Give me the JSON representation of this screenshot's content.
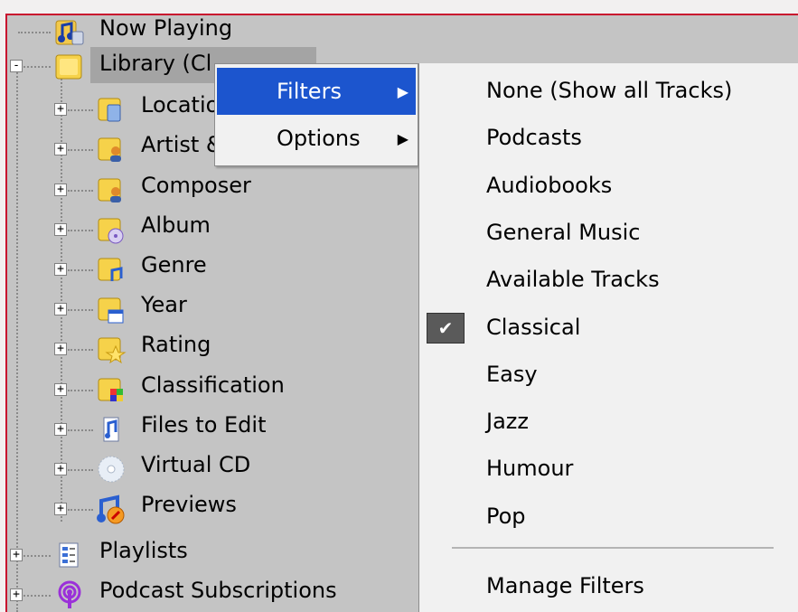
{
  "tree": {
    "items": [
      {
        "label": "Now Playing",
        "icon": "now-playing-icon",
        "expander": ""
      },
      {
        "label": "Library (Cl",
        "icon": "library-folder-icon",
        "expander": "-"
      },
      {
        "label": "Locatio",
        "icon": "location-folder-icon",
        "expander": "+"
      },
      {
        "label": "Artist &",
        "icon": "artist-folder-icon",
        "expander": "+"
      },
      {
        "label": "Composer",
        "icon": "composer-folder-icon",
        "expander": "+"
      },
      {
        "label": "Album",
        "icon": "album-folder-icon",
        "expander": "+"
      },
      {
        "label": "Genre",
        "icon": "genre-folder-icon",
        "expander": "+"
      },
      {
        "label": "Year",
        "icon": "year-folder-icon",
        "expander": "+"
      },
      {
        "label": "Rating",
        "icon": "rating-folder-icon",
        "expander": "+"
      },
      {
        "label": "Classification",
        "icon": "classification-folder-icon",
        "expander": "+"
      },
      {
        "label": "Files to Edit",
        "icon": "files-to-edit-icon",
        "expander": "+"
      },
      {
        "label": "Virtual CD",
        "icon": "virtual-cd-icon",
        "expander": "+"
      },
      {
        "label": "Previews",
        "icon": "previews-icon",
        "expander": "+"
      },
      {
        "label": "Playlists",
        "icon": "playlists-icon",
        "expander": "+"
      },
      {
        "label": "Podcast Subscriptions",
        "icon": "podcast-icon",
        "expander": "+"
      }
    ]
  },
  "context_menu": {
    "items": [
      {
        "label": "Filters",
        "arrow": "▶",
        "active": true
      },
      {
        "label": "Options",
        "arrow": "▶",
        "active": false
      }
    ]
  },
  "filters_menu": {
    "items": [
      {
        "label": "None (Show all Tracks)",
        "checked": false
      },
      {
        "label": "Podcasts",
        "checked": false
      },
      {
        "label": "Audiobooks",
        "checked": false
      },
      {
        "label": "General Music",
        "checked": false
      },
      {
        "label": "Available Tracks",
        "checked": false
      },
      {
        "label": "Classical",
        "checked": true
      },
      {
        "label": "Easy",
        "checked": false
      },
      {
        "label": "Jazz",
        "checked": false
      },
      {
        "label": "Humour",
        "checked": false
      },
      {
        "label": "Pop",
        "checked": false
      }
    ],
    "manage_label": "Manage Filters",
    "check_glyph": "✔"
  },
  "colors": {
    "accent": "#1c55ce",
    "window_border": "#c8102e",
    "tree_background": "#c4c4c4",
    "menu_background": "#f1f1f1"
  }
}
